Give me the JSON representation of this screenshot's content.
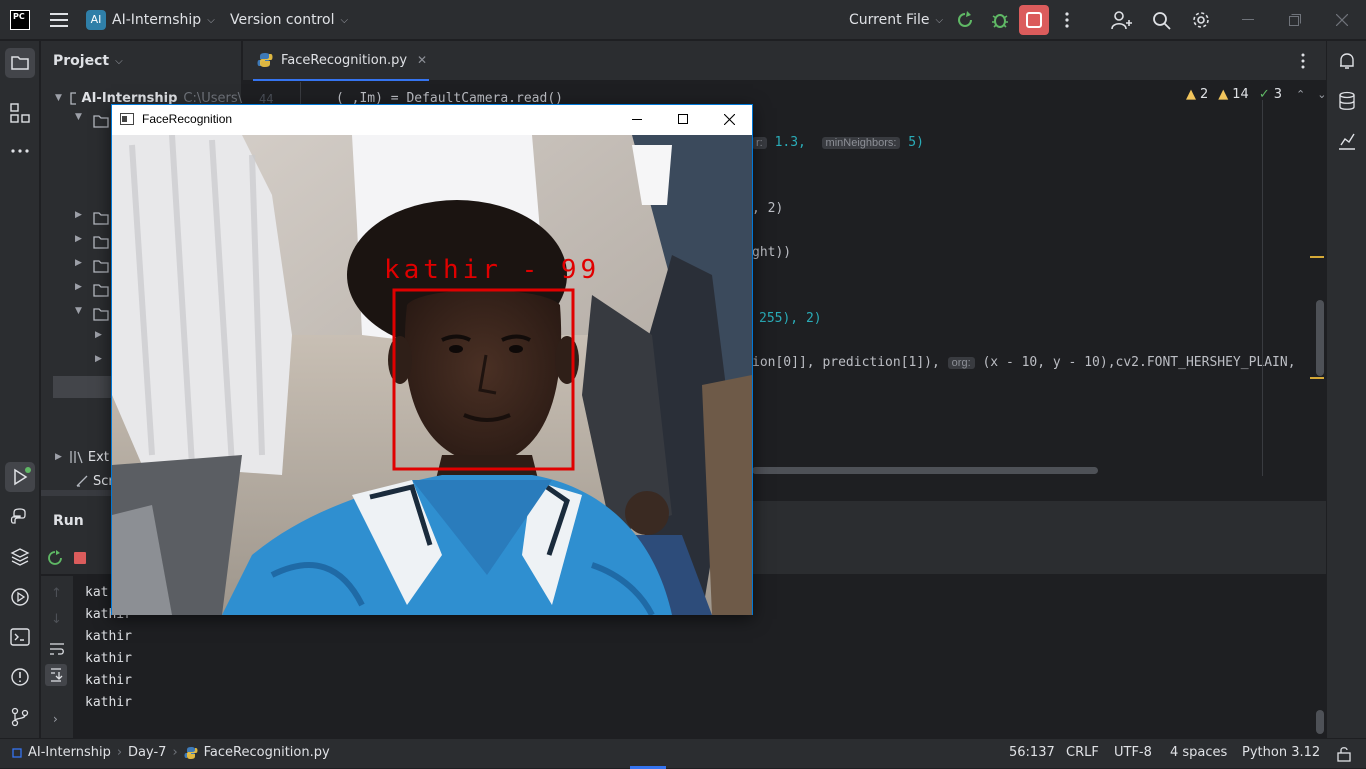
{
  "app": {
    "logo": "PC",
    "project_name": "AI-Internship",
    "version_control": "Version control",
    "run_config": "Current File"
  },
  "project_panel": {
    "title": "Project",
    "root_label": "AI-Internship",
    "root_path": "C:\\Users\\",
    "external_label": "Ext",
    "scratches_label": "Scr"
  },
  "editor": {
    "tab_label": "FaceRecognition.py",
    "inspections": {
      "warnings": "2",
      "weak_warnings": "14",
      "ok": "3"
    },
    "line_number": "44",
    "line1": "(_,Im) = DefaultCamera.read()",
    "line2_hint_a": "r:",
    "line2_val_a": "1.3,",
    "line2_hint_b": "minNeighbors:",
    "line2_val_b": "5)",
    "line3": ", 2)",
    "line4": "ght))",
    "line5_num": "255), 2)",
    "line6_pre": "ion[0]], prediction[1]),",
    "line6_hint": "org:",
    "line6_post": "(x - 10, y - 10),cv2.FONT_HERSHEY_PLAIN,"
  },
  "run": {
    "tab_label": "Run",
    "output_lines": [
      "kat",
      "kathir",
      "kathir",
      "kathir",
      "kathir",
      "kathir"
    ]
  },
  "face_window": {
    "title": "FaceRecognition",
    "overlay_label": "kathir - 99",
    "box_color": "#e00000"
  },
  "status": {
    "breadcrumb": [
      "AI-Internship",
      "Day-7",
      "FaceRecognition.py"
    ],
    "position": "56:137",
    "line_endings": "CRLF",
    "encoding": "UTF-8",
    "indent": "4 spaces",
    "interpreter": "Python 3.12"
  },
  "colors": {
    "accent": "#3574f0",
    "stop_button": "#db5c5c",
    "run_green": "#5fb865"
  }
}
